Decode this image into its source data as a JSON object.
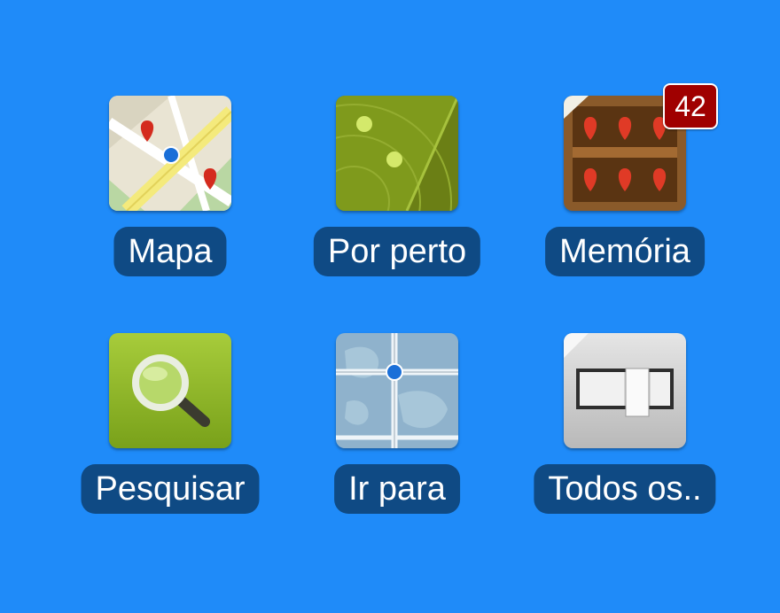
{
  "apps": [
    {
      "label": "Mapa",
      "icon": "map-icon"
    },
    {
      "label": "Por perto",
      "icon": "radar-icon"
    },
    {
      "label": "Memória",
      "icon": "pin-shelf-icon",
      "badge": "42"
    },
    {
      "label": "Pesquisar",
      "icon": "magnifier-icon"
    },
    {
      "label": "Ir para",
      "icon": "globe-crosshair-icon"
    },
    {
      "label": "Todos os..",
      "icon": "all-items-box-icon"
    }
  ],
  "colors": {
    "background": "#1f8bf9",
    "label_background": "#0f4a84",
    "badge": "#a00000"
  }
}
